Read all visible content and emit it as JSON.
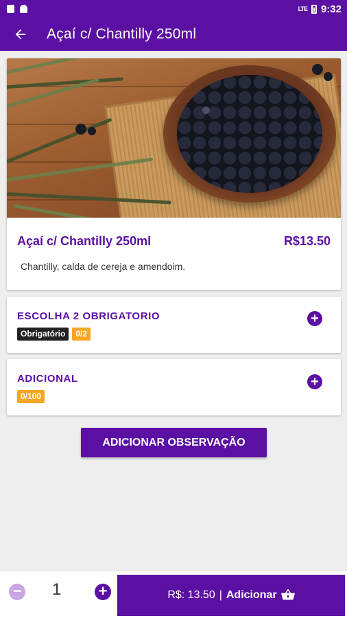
{
  "statusbar": {
    "time": "9:32",
    "signal": "LTE"
  },
  "appbar": {
    "title": "Açaí c/ Chantilly 250ml"
  },
  "product": {
    "name": "Açaí c/ Chantilly 250ml",
    "price": "R$13.50",
    "description": "Chantilly, calda de cereja e amendoim."
  },
  "options": [
    {
      "title": "ESCOLHA 2 OBRIGATORIO",
      "required_badge": "Obrigatório",
      "count": "0/2"
    },
    {
      "title": "ADICIONAL",
      "count": "0/100"
    }
  ],
  "observation_button": "ADICIONAR OBSERVAÇÃO",
  "bottom": {
    "minus": "−",
    "quantity": "1",
    "plus": "+",
    "total": "R$: 13.50",
    "separator": "|",
    "add_label": "Adicionar"
  },
  "colors": {
    "primary": "#5b10a3",
    "badge_dark": "#222222",
    "badge_orange": "#f5a623",
    "disabled": "#c9a6e3"
  },
  "icons": [
    "back-arrow-icon",
    "add-circle-icon",
    "remove-circle-icon",
    "basket-icon"
  ]
}
